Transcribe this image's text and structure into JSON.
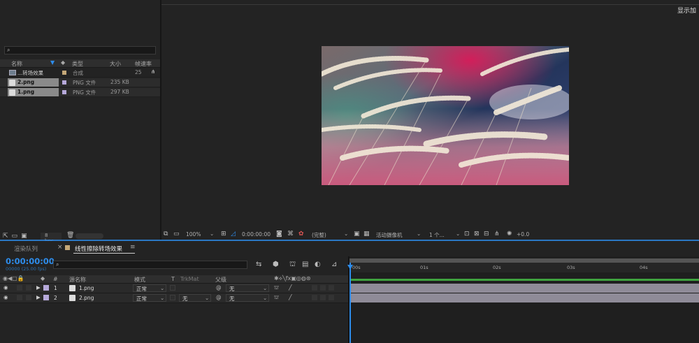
{
  "project": {
    "search_placeholder": "",
    "columns": {
      "name": "名称",
      "type": "类型",
      "size": "大小",
      "framerate": "帧速率"
    },
    "items": [
      {
        "name": "...转场效果",
        "swatch": "#c5a878",
        "type": "合成",
        "size": "",
        "fps": "25"
      },
      {
        "name": "2.png",
        "swatch": "#b6a9da",
        "type": "PNG 文件",
        "size": "235 KB",
        "fps": ""
      },
      {
        "name": "1.png",
        "swatch": "#b6a9da",
        "type": "PNG 文件",
        "size": "297 KB",
        "fps": ""
      }
    ],
    "bpc": "8 bpc"
  },
  "comp": {
    "top_right": "显示加",
    "zoom": "100%",
    "timecode": "0:00:00:00",
    "resolution": "(完整)",
    "camera": "活动摄像机",
    "views": "1 个...",
    "exposure": "+0.0"
  },
  "timeline": {
    "tab_render": "渲染队列",
    "tab_comp": "线性擦除转场效果",
    "current_time": "0:00:00:00",
    "frame_info": "00000 (25.00 fps)",
    "col_num": "#",
    "col_source": "源名称",
    "col_mode": "模式",
    "col_t": "T",
    "col_trkmat": "TrkMat",
    "col_parent": "父级",
    "layers": [
      {
        "num": "1",
        "name": "1.png",
        "mode": "正常",
        "trkmat": "",
        "parent": "无"
      },
      {
        "num": "2",
        "name": "2.png",
        "mode": "正常",
        "trkmat": "无",
        "parent": "无"
      }
    ],
    "ruler": [
      "00s",
      "01s",
      "02s",
      "03s",
      "04s"
    ]
  },
  "colors": {
    "accent": "#2d8ceb",
    "layer_label": "#b6a9da",
    "comp_label": "#c5a878",
    "green_bar": "#3fa33f",
    "layer_bar": "#8f8b98"
  }
}
